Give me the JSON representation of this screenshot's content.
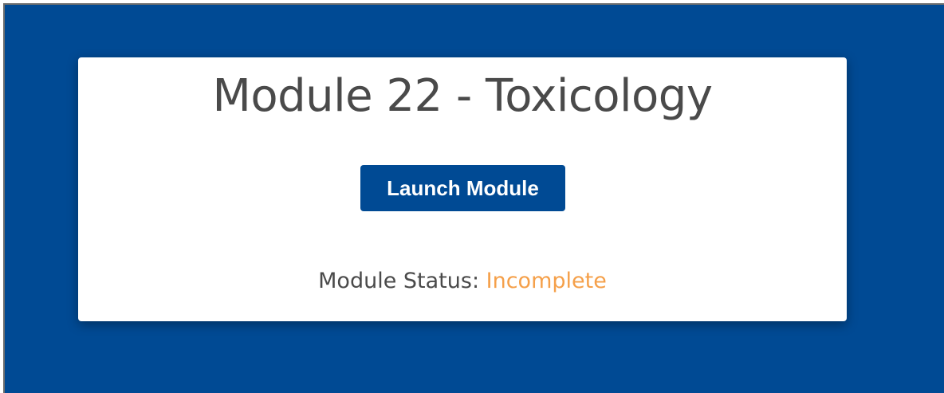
{
  "module": {
    "title": "Module 22 - Toxicology",
    "launch_label": "Launch Module",
    "status_label": "Module Status:",
    "status_value": "Incomplete"
  },
  "colors": {
    "background": "#004a94",
    "button": "#004a94",
    "status_incomplete": "#f5a04a",
    "title_text": "#4a4a4a"
  }
}
